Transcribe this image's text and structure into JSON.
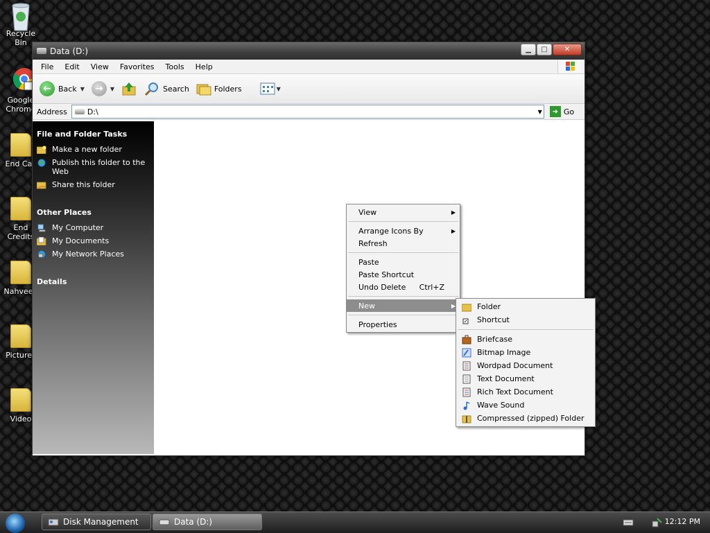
{
  "desktop": {
    "icons": [
      {
        "label": "Recycle Bin"
      },
      {
        "label": "Google Chrome"
      },
      {
        "label": "End Call"
      },
      {
        "label": "End Credits"
      },
      {
        "label": "Nahveen"
      },
      {
        "label": "Pictures"
      },
      {
        "label": "Video"
      }
    ]
  },
  "window": {
    "title": "Data (D:)",
    "buttons": {
      "minimize": "▁",
      "maximize": "□",
      "close": "✕"
    }
  },
  "menubar": {
    "items": [
      "File",
      "Edit",
      "View",
      "Favorites",
      "Tools",
      "Help"
    ]
  },
  "toolbar": {
    "back": "Back",
    "search": "Search",
    "folders": "Folders"
  },
  "address": {
    "label": "Address",
    "value": "D:\\",
    "go": "Go"
  },
  "sidebar": {
    "tasks_title": "File and Folder Tasks",
    "tasks": [
      "Make a new folder",
      "Publish this folder to the Web",
      "Share this folder"
    ],
    "places_title": "Other Places",
    "places": [
      "My Computer",
      "My Documents",
      "My Network Places"
    ],
    "details_title": "Details"
  },
  "context_menu": {
    "view": "View",
    "arrange": "Arrange Icons By",
    "refresh": "Refresh",
    "paste": "Paste",
    "paste_shortcut": "Paste Shortcut",
    "undo_delete": "Undo Delete",
    "undo_shortcut": "Ctrl+Z",
    "new": "New",
    "properties": "Properties"
  },
  "new_submenu": {
    "folder": "Folder",
    "shortcut": "Shortcut",
    "items": [
      {
        "label": "Briefcase",
        "color": "#b5651d"
      },
      {
        "label": "Bitmap Image",
        "color": "#3b6fc9"
      },
      {
        "label": "Wordpad Document",
        "color": "#c9453b"
      },
      {
        "label": "Text Document",
        "color": "#8a8a8a"
      },
      {
        "label": "Rich Text Document",
        "color": "#c9453b"
      },
      {
        "label": "Wave Sound",
        "color": "#2a6fd6"
      },
      {
        "label": "Compressed (zipped) Folder",
        "color": "#d6b63b"
      }
    ]
  },
  "taskbar": {
    "tasks": [
      "Disk Management",
      "Data (D:)"
    ],
    "clock": "12:12 PM"
  }
}
